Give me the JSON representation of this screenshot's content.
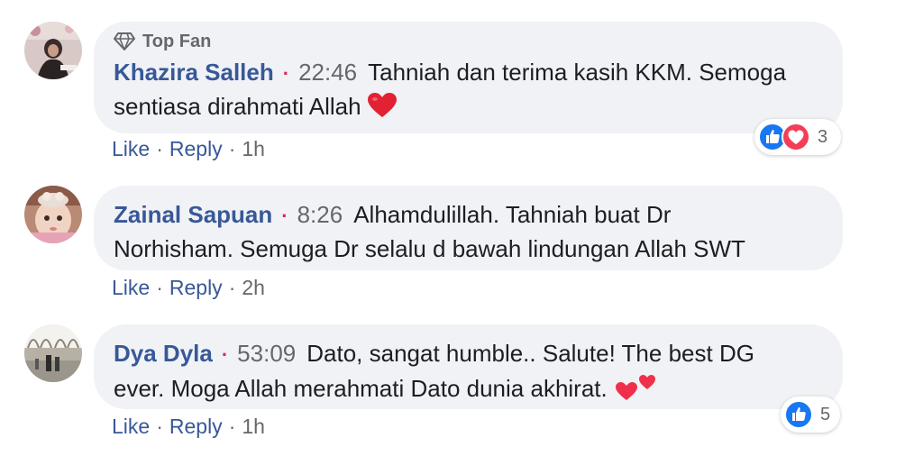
{
  "comments": [
    {
      "badge": "Top Fan",
      "author": "Khazira Salleh",
      "time": "22:46",
      "text_line1": "Tahniah dan terima kasih KKM. Semoga",
      "text_line2": "sentiasa dirahmati Allah",
      "like": "Like",
      "reply": "Reply",
      "age": "1h",
      "reaction_count": "3",
      "reactions": [
        "like-icon",
        "love-icon"
      ]
    },
    {
      "author": "Zainal Sapuan",
      "time": "8:26",
      "text_line1": "Alhamdulillah. Tahniah buat Dr",
      "text_line2": "Norhisham. Semuga Dr selalu d bawah lindungan Allah SWT",
      "like": "Like",
      "reply": "Reply",
      "age": "2h"
    },
    {
      "author": "Dya Dyla",
      "time": "53:09",
      "text_line1": "Dato, sangat humble.. Salute! The best DG",
      "text_line2": "ever. Moga Allah merahmati Dato dunia akhirat.",
      "like": "Like",
      "reply": "Reply",
      "age": "1h",
      "reaction_count": "5",
      "reactions": [
        "like-icon"
      ]
    }
  ],
  "separator_dot": "·",
  "colors": {
    "author": "#385898",
    "bubble": "#f0f2f5",
    "meta": "#65676b",
    "like_blue": "#1877f2",
    "love_red": "#f33e58"
  }
}
